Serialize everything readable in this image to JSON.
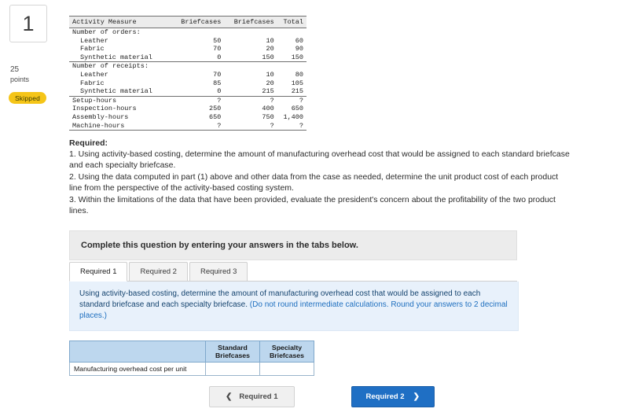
{
  "left_rail": {
    "question_number": "1",
    "points_value": "25",
    "points_label": "points",
    "status_badge": "Skipped"
  },
  "data_table": {
    "headers": [
      "Activity Measure",
      "Briefcases",
      "Briefcases",
      "Total"
    ],
    "rows": [
      {
        "label": "Number of orders:",
        "indent": false,
        "values": [
          "",
          "",
          ""
        ]
      },
      {
        "label": "Leather",
        "indent": true,
        "values": [
          "50",
          "10",
          "60"
        ]
      },
      {
        "label": "Fabric",
        "indent": true,
        "values": [
          "70",
          "20",
          "90"
        ]
      },
      {
        "label": "Synthetic material",
        "indent": true,
        "values": [
          "0",
          "150",
          "150"
        ]
      },
      {
        "label": "Number of receipts:",
        "indent": false,
        "values": [
          "",
          "",
          ""
        ]
      },
      {
        "label": "Leather",
        "indent": true,
        "values": [
          "70",
          "10",
          "80"
        ]
      },
      {
        "label": "Fabric",
        "indent": true,
        "values": [
          "85",
          "20",
          "105"
        ]
      },
      {
        "label": "Synthetic material",
        "indent": true,
        "values": [
          "0",
          "215",
          "215"
        ]
      },
      {
        "label": "Setup-hours",
        "indent": false,
        "values": [
          "?",
          "?",
          "?"
        ]
      },
      {
        "label": "Inspection-hours",
        "indent": false,
        "values": [
          "250",
          "400",
          "650"
        ]
      },
      {
        "label": "Assembly-hours",
        "indent": false,
        "values": [
          "650",
          "750",
          "1,400"
        ]
      },
      {
        "label": "Machine-hours",
        "indent": false,
        "values": [
          "?",
          "?",
          "?"
        ]
      }
    ]
  },
  "requirements": {
    "heading": "Required:",
    "items": [
      "1. Using activity-based costing, determine the amount of manufacturing overhead cost that would be assigned to each standard briefcase and each specialty briefcase.",
      "2. Using the data computed in part (1) above and other data from the case as needed, determine the unit product cost of each product line from the perspective of the activity-based costing system.",
      "3. Within the limitations of the data that have been provided, evaluate the president's concern about the profitability of the two product lines."
    ]
  },
  "answer_card": {
    "header": "Complete this question by entering your answers in the tabs below.",
    "tabs": [
      {
        "label": "Required 1",
        "active": true
      },
      {
        "label": "Required 2",
        "active": false
      },
      {
        "label": "Required 3",
        "active": false
      }
    ],
    "instruction_main": "Using activity-based costing, determine the amount of manufacturing overhead cost that would be assigned to each standard briefcase and each specialty briefcase.",
    "instruction_note": "(Do not round intermediate calculations. Round your answers to 2 decimal places.)",
    "entry_table": {
      "corner_header": "",
      "column_headers": [
        "Standard Briefcases",
        "Specialty Briefcases"
      ],
      "rows": [
        {
          "label": "Manufacturing overhead cost per unit",
          "values": [
            "",
            ""
          ]
        }
      ]
    },
    "nav": {
      "prev_label": "Required 1",
      "prev_icon": "chevron-left-icon",
      "next_label": "Required 2",
      "next_icon": "chevron-right-icon"
    }
  }
}
